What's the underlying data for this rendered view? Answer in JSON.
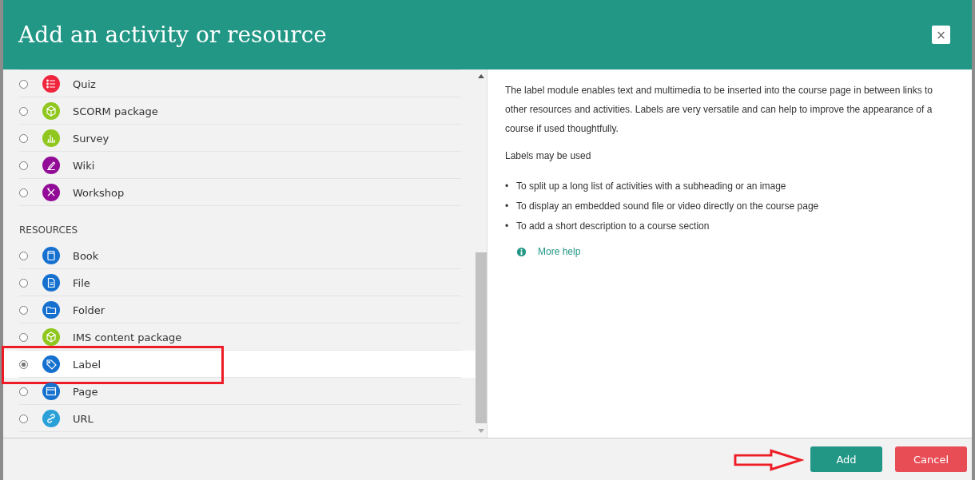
{
  "dialog": {
    "title": "Add an activity or resource",
    "close_icon": "×"
  },
  "sections": [
    {
      "items": [
        {
          "label": "Quiz",
          "kind": "list",
          "color": "#f0263e",
          "selected": false,
          "highlighted": false
        },
        {
          "label": "SCORM package",
          "kind": "cube",
          "color": "#8fc71e",
          "selected": false,
          "highlighted": false
        },
        {
          "label": "Survey",
          "kind": "chart",
          "color": "#8fc71e",
          "selected": false,
          "highlighted": false
        },
        {
          "label": "Wiki",
          "kind": "pencil",
          "color": "#920c97",
          "selected": false,
          "highlighted": false
        },
        {
          "label": "Workshop",
          "kind": "tools",
          "color": "#920c97",
          "selected": false,
          "highlighted": false
        }
      ]
    },
    {
      "heading": "RESOURCES",
      "items": [
        {
          "label": "Book",
          "kind": "book",
          "color": "#1670cf",
          "selected": false,
          "highlighted": false
        },
        {
          "label": "File",
          "kind": "file",
          "color": "#1670cf",
          "selected": false,
          "highlighted": false
        },
        {
          "label": "Folder",
          "kind": "folder",
          "color": "#1670cf",
          "selected": false,
          "highlighted": false
        },
        {
          "label": "IMS content package",
          "kind": "cube",
          "color": "#8fc71e",
          "selected": false,
          "highlighted": false
        },
        {
          "label": "Label",
          "kind": "tag",
          "color": "#1670cf",
          "selected": true,
          "highlighted": true
        },
        {
          "label": "Page",
          "kind": "window",
          "color": "#1670cf",
          "selected": false,
          "highlighted": false
        },
        {
          "label": "URL",
          "kind": "link",
          "color": "#2aa0d8",
          "selected": false,
          "highlighted": false
        }
      ]
    }
  ],
  "help": {
    "description": "The label module enables text and multimedia to be inserted into the course page in between links to other resources and activities. Labels are very versatile and can help to improve the appearance of a course if used thoughtfully.",
    "intro": "Labels may be used",
    "uses": [
      {
        "marker": "•",
        "text": "To split up a long list of activities with a subheading or an image"
      },
      {
        "marker": "•",
        "text": "To display an embedded sound file or video directly on the course page"
      },
      {
        "marker": "•",
        "text": "To add a short description to a course section"
      }
    ],
    "more_help": "More help"
  },
  "buttons": [
    {
      "label": "Add",
      "kind": "primary",
      "arrow": true
    },
    {
      "label": "Cancel",
      "kind": "danger",
      "arrow": false
    }
  ]
}
